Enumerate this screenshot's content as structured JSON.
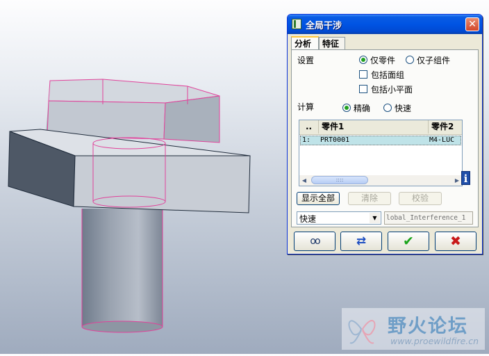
{
  "dialog": {
    "title": "全局干涉",
    "close_glyph": "✕",
    "tabs": [
      {
        "label": "分析",
        "active": true
      },
      {
        "label": "特征",
        "active": false
      }
    ],
    "settings": {
      "label": "设置",
      "radio_parts_only": "仅零件",
      "radio_subassembly_only": "仅子组件",
      "selected": "仅零件",
      "check_include_quilts": "包括面组",
      "check_include_facets": "包括小平面"
    },
    "compute": {
      "label": "计算",
      "radio_exact": "精确",
      "radio_quick": "快速",
      "selected": "精确"
    },
    "table": {
      "columns": [
        "..",
        "零件1",
        "零件2"
      ],
      "rows": [
        {
          "index": "1:",
          "part1": "PRT0001",
          "part2": "M4-LUC"
        }
      ]
    },
    "scroll_thumb_glyph": "::::",
    "info_glyph": "i",
    "buttons": {
      "show_all": "显示全部",
      "clear": "清除",
      "verify": "校验"
    },
    "mode_select": {
      "value": "快速"
    },
    "name_field": {
      "value": "lobal_Interference_1"
    },
    "bottom_buttons": {
      "preview": "glasses-icon",
      "repaint": "refresh-icon",
      "ok": "check-icon",
      "cancel": "cancel-icon"
    },
    "glyphs": {
      "ok": "✔",
      "cancel": "✖",
      "repaint": "⇄",
      "preview": "oo"
    }
  },
  "watermark": {
    "title": "野火论坛",
    "url": "www.proewildfire.cn"
  },
  "colors": {
    "titlebar": "#0054e3",
    "dialog_bg": "#ece9d8",
    "selected_row": "#bfe3e8",
    "interference_edge": "#e0429a",
    "ok_green": "#1aa41a",
    "cancel_red": "#c81919"
  }
}
